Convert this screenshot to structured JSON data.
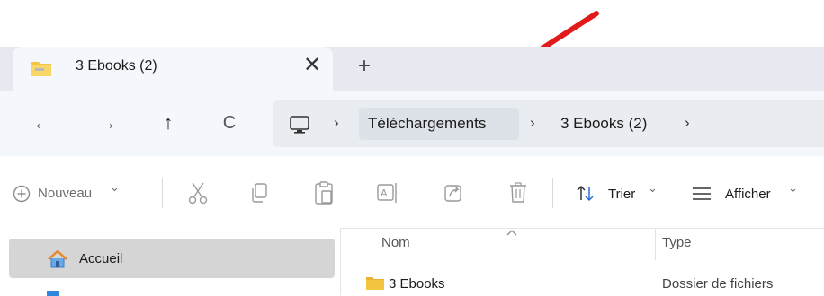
{
  "tab": {
    "title": "3 Ebooks (2)",
    "close_glyph": "✕",
    "new_tab_glyph": "+"
  },
  "nav": {
    "back": "←",
    "forward": "→",
    "up": "↑",
    "refresh": "C"
  },
  "breadcrumb": [
    "Téléchargements",
    "3 Ebooks (2)"
  ],
  "breadcrumb_sep": "›",
  "toolbar": {
    "new_label": "Nouveau",
    "sort_label": "Trier",
    "view_label": "Afficher",
    "chevron": "⌄"
  },
  "sidebar": {
    "home_label": "Accueil"
  },
  "columns": {
    "name": "Nom",
    "type": "Type"
  },
  "rows": [
    {
      "name": "3 Ebooks",
      "type": "Dossier de fichiers"
    }
  ],
  "colors": {
    "arrow": "#e11a1a",
    "folder": "#f4c540",
    "home_icon": "#e8862a"
  },
  "icons": [
    "zip-folder-icon",
    "close-icon",
    "plus-icon",
    "back-arrow-icon",
    "forward-arrow-icon",
    "up-arrow-icon",
    "refresh-icon",
    "computer-icon",
    "plus-circle-icon",
    "cut-icon",
    "copy-icon",
    "paste-icon",
    "rename-icon",
    "share-icon",
    "delete-icon",
    "sort-icon",
    "view-icon",
    "home-icon",
    "folder-icon",
    "sort-caret-icon"
  ]
}
